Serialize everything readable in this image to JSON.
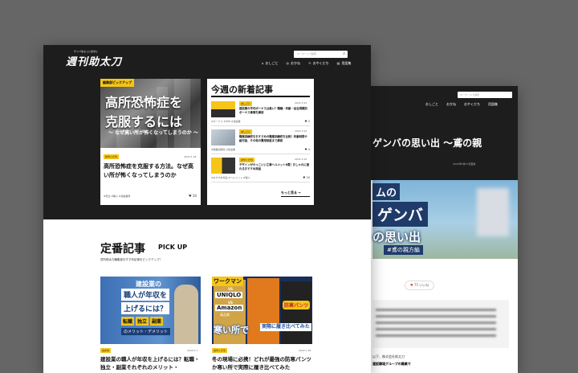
{
  "back": {
    "search_placeholder": "キーワードで検索",
    "nav": [
      "おしごと",
      "おかね",
      "おやくだち",
      "用語集"
    ],
    "title": "ゲンバの思い出 〜鳶の親",
    "date": "2021年3月27日更新",
    "hero": {
      "l1": "ムの",
      "l2": "ゲンバ",
      "l3": "の思い出",
      "l4": "#鳶の親方編"
    },
    "likes": "75 いいね",
    "para1": "以下、株式会社助太刀",
    "para2_prefix": "",
    "para2_bold": "建設職場グループの職業で"
  },
  "front": {
    "logo": "週刊助太刀",
    "logo_sub": "ゲンバをもっと好きに",
    "search_placeholder": "キーワードで検索",
    "nav": [
      {
        "icon": "person-icon",
        "label": "おしごと"
      },
      {
        "icon": "coin-icon",
        "label": "おかね"
      },
      {
        "icon": "bulb-icon",
        "label": "おやくだち"
      },
      {
        "icon": "book-icon",
        "label": "用語集"
      }
    ],
    "feature": {
      "badge": "編集部ピックアップ",
      "big1": "高所恐怖症を",
      "big2": "克服するには",
      "sub": "〜 なぜ高い所が怖くなってしまうのか 〜",
      "tag": "おやくだち",
      "date": "2022.1.18",
      "title": "高所恐怖症を克服する方法。なぜ高い所が怖くなってしまうのか",
      "cats": "#安全  #職人  #建設業界",
      "likes": "14"
    },
    "weekly": {
      "heading": "今週の新着記事",
      "items": [
        {
          "tag": "おしごと",
          "date": "2022.3.22",
          "title": "建設業の平均ボーナスは高い？職種・年齢・会社規模別ボーナス事情を解説",
          "cats": "#ボーナス  #平均  #建設業",
          "count": "2"
        },
        {
          "tag": "おしごと",
          "date": "2022.3.22",
          "title": "職業訓練校をおすすめの職業訓練校を比較！年齢制限や給付金、その他の費用制度まで解説",
          "cats": "#職業訓練校  #建設業",
          "count": "4"
        },
        {
          "tag": "おやくだち",
          "date": "2022.3.19",
          "title": "デザインがかっこいい工事ヘルメット6選！おしゃれに被れるおすすめ商品",
          "cats": "#おすすめ商品  #ヘルメット  #職人",
          "count": "20"
        }
      ],
      "more": "もっと見る →"
    },
    "pickup": {
      "title": "定番記事",
      "sub": "PICK UP",
      "desc": "週刊助太刀編集部おすすめ記事をピックアップ！",
      "cards": [
        {
          "tag": "おかね",
          "date": "2022.1.7",
          "title": "建設業の職人が年収を上げるには？転職・独立・副業それぞれのメリット・",
          "img": {
            "a": "建設業の",
            "b": "職人が年収を",
            "c": "上げるには？",
            "d": [
              "転職",
              "独立",
              "副業"
            ],
            "e": "のメリット・デメリット"
          }
        },
        {
          "tag": "おやくだち",
          "date": "2022.1.26",
          "title": "冬の現場に必携！どれが最強の防寒パンツか寒い所で実際に履き比べてみた",
          "img": {
            "w": "ワークマン",
            "vs": "VS",
            "u": "UNIQLO",
            "am": "Amazon",
            "gd": "高品質",
            "badge": "防寒パンツ",
            "samu": "寒い所で",
            "cmp": "実際に履き比べてみた"
          }
        }
      ]
    }
  }
}
